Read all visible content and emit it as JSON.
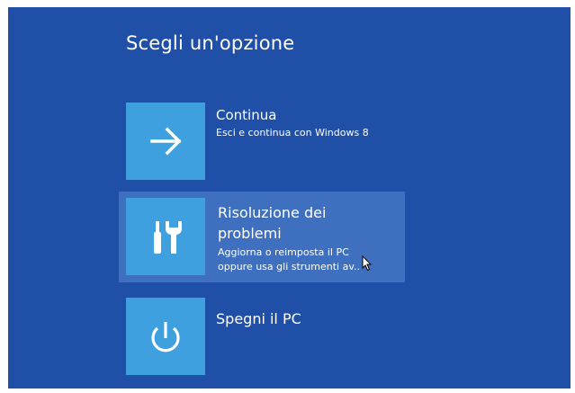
{
  "screen": {
    "title": "Scegli un'opzione",
    "background_color": "#1f4fa6",
    "tile_color": "#3ea0de",
    "highlight_color": "#3f6fbf"
  },
  "options": [
    {
      "title": "Continua",
      "description": "Esci e continua con Windows 8",
      "icon": "arrow-right-icon",
      "highlighted": false
    },
    {
      "title_line1": "Risoluzione dei",
      "title_line2": "problemi",
      "description_line1": "Aggiorna o reimposta il PC",
      "description_line2": "oppure usa gli strumenti av..",
      "icon": "tools-icon",
      "highlighted": true
    },
    {
      "title": "Spegni il PC",
      "icon": "power-icon",
      "highlighted": false
    }
  ]
}
